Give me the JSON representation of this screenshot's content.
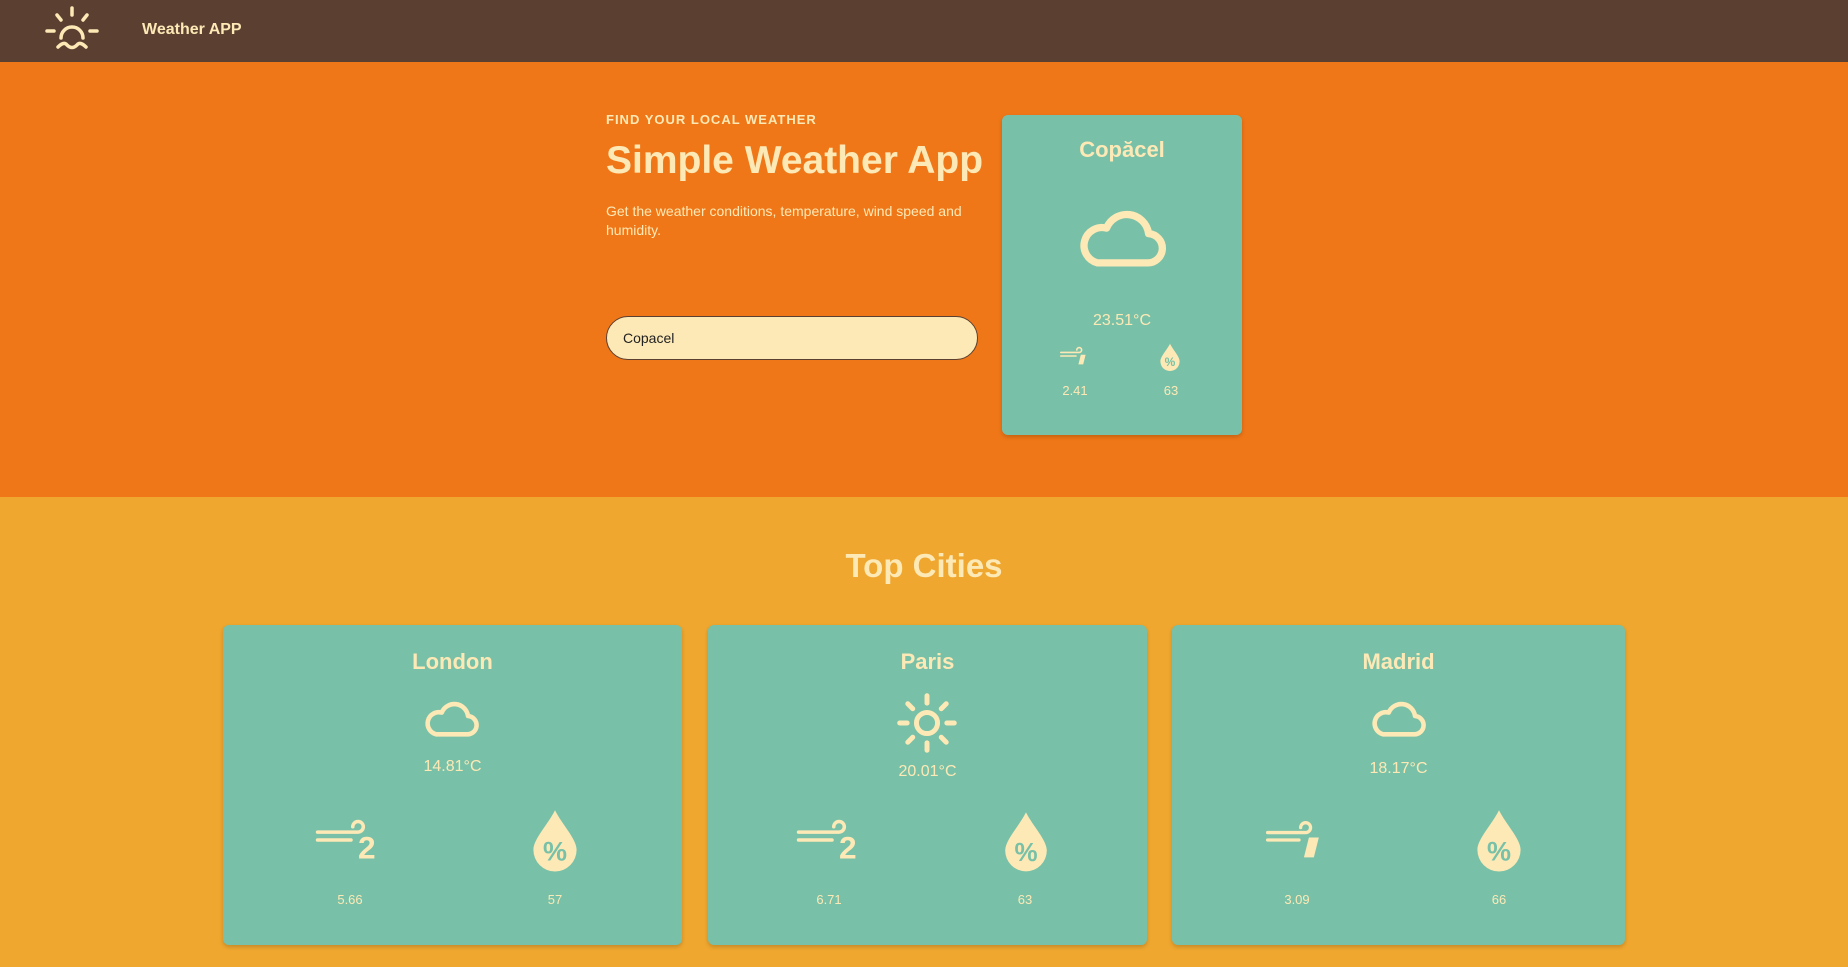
{
  "navbar": {
    "title": "Weather APP",
    "logo_icon": "sunrise-icon"
  },
  "hero": {
    "eyebrow": "FIND YOUR LOCAL WEATHER",
    "title": "Simple Weather App",
    "description": "Get the weather conditions, temperature, wind speed and humidity.",
    "search_value": "Copacel"
  },
  "current": {
    "city": "Copăcel",
    "icon": "cloud-icon",
    "temperature": "23.51°C",
    "wind_icon": "wind-speed-1-icon",
    "wind": "2.41",
    "humidity_icon": "humidity-drop-icon",
    "humidity": "63"
  },
  "top_cities": {
    "title": "Top Cities",
    "cities": [
      {
        "name": "London",
        "icon": "cloud-icon",
        "temperature": "14.81°C",
        "wind_icon": "wind-speed-2-icon",
        "wind": "5.66",
        "humidity": "57"
      },
      {
        "name": "Paris",
        "icon": "sun-icon",
        "temperature": "20.01°C",
        "wind_icon": "wind-speed-2-icon",
        "wind": "6.71",
        "humidity": "63"
      },
      {
        "name": "Madrid",
        "icon": "cloud-icon",
        "temperature": "18.17°C",
        "wind_icon": "wind-speed-1-icon",
        "wind": "3.09",
        "humidity": "66"
      }
    ]
  },
  "colors": {
    "navbar": "#5b4032",
    "hero": "#ef7718",
    "section": "#efa72f",
    "card": "#78c1a8",
    "text": "#fde9b6"
  }
}
